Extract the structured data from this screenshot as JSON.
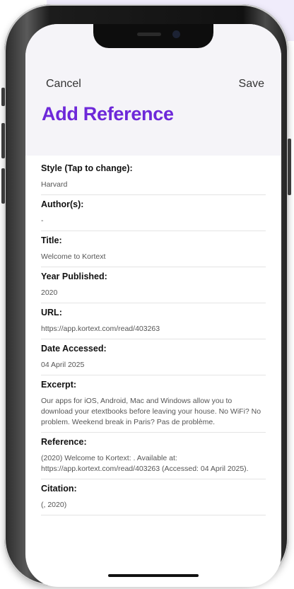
{
  "header": {
    "cancel_label": "Cancel",
    "save_label": "Save",
    "title": "Add Reference"
  },
  "fields": {
    "style": {
      "label": "Style (Tap to change):",
      "value": "Harvard"
    },
    "authors": {
      "label": "Author(s):",
      "value": "-"
    },
    "title": {
      "label": "Title:",
      "value": "Welcome to Kortext"
    },
    "year": {
      "label": "Year Published:",
      "value": "2020"
    },
    "url": {
      "label": "URL:",
      "value": "https://app.kortext.com/read/403263"
    },
    "date_accessed": {
      "label": "Date Accessed:",
      "value": "04 April 2025"
    },
    "excerpt": {
      "label": "Excerpt:",
      "value": "Our apps for iOS, Android, Mac and Windows allow you to download your etextbooks before leaving your house. No WiFi? No problem. Weekend break in Paris? Pas de problème."
    },
    "reference": {
      "label": "Reference:",
      "value": " (2020) Welcome to Kortext: . Available at: https://app.kortext.com/read/403263 (Accessed: 04 April 2025)."
    },
    "citation": {
      "label": "Citation:",
      "value": "(, 2020)"
    }
  },
  "colors": {
    "accent": "#6d28d9",
    "header_bg": "#f5f4f8",
    "background_tint": "#f0ecfb"
  }
}
